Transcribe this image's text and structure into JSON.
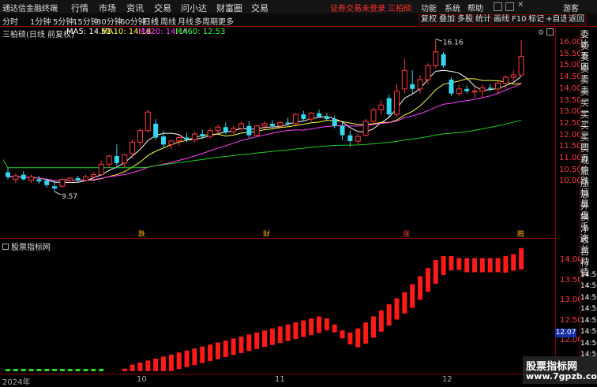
{
  "menubar": {
    "app_title": "通达信金融终端",
    "items": [
      "行情",
      "市场",
      "资讯",
      "交易",
      "问小达",
      "财富圈",
      "交易"
    ],
    "notice": "证券交易未登录  三柏硕",
    "right_items": [
      "功能",
      "系统",
      "帮助",
      "游客"
    ]
  },
  "toolbar": {
    "periods": [
      "分时",
      "1分钟",
      "5分钟",
      "15分钟",
      "30分钟",
      "60分钟",
      "日线",
      "周线",
      "月线",
      "多周期",
      "更多"
    ],
    "active_period": "日线",
    "tools": [
      "复权",
      "叠加",
      "多股",
      "统计",
      "画线",
      "F10",
      "标记",
      "+自选",
      "返回"
    ]
  },
  "main": {
    "stock_name": "三柏硕",
    "adjust_note": "(日线 前复权)",
    "ma": [
      {
        "label": "MA5: 14.51",
        "color": "#ffffff"
      },
      {
        "label": "MA10: 14.18",
        "color": "#ffff40"
      },
      {
        "label": "MA20: 14.14",
        "color": "#ff40ff"
      },
      {
        "label": "MA60: 12.53",
        "color": "#40ff40"
      }
    ],
    "high_label": "16.16",
    "low_label": "9.57",
    "price_axis": [
      "16.00",
      "15.50",
      "15.00",
      "14.50",
      "14.00",
      "13.50",
      "13.00",
      "12.50",
      "12.00",
      "11.50",
      "11.00",
      "10.50",
      "10.00"
    ],
    "markers": [
      "跌",
      "财",
      "涨",
      "腾"
    ]
  },
  "sub": {
    "title": "股票指标网",
    "axis": [
      "14.00",
      "13.50",
      "13.00",
      "12.50",
      "12.00",
      "11.50",
      "11.00"
    ],
    "current_value": "12.07"
  },
  "sidepanel": [
    "委比",
    "卖五",
    "卖四",
    "卖三",
    "卖二",
    "卖一",
    "买一",
    "买二",
    "买三",
    "买四",
    "买五",
    "现价",
    "涨跌",
    "涨幅",
    "总量",
    "外盘",
    "换手",
    "净资",
    "收益",
    "自动",
    "行情",
    "14:50",
    "14:50",
    "14:50",
    "14:50",
    "14:50",
    "14:50",
    "14:50",
    "14:50",
    "14:50"
  ],
  "xaxis": [
    "2024年",
    "10",
    "11",
    "12"
  ],
  "watermark": {
    "line1": "股票指标网",
    "line2": "www.7gpzb.com"
  },
  "chart_data": {
    "type": "candlestick",
    "candles": [
      {
        "o": 10.4,
        "h": 10.6,
        "l": 10.1,
        "c": 10.2
      },
      {
        "o": 10.1,
        "h": 10.35,
        "l": 9.95,
        "c": 10.25
      },
      {
        "o": 10.3,
        "h": 10.45,
        "l": 10.05,
        "c": 10.1
      },
      {
        "o": 10.05,
        "h": 10.3,
        "l": 9.95,
        "c": 10.2
      },
      {
        "o": 10.1,
        "h": 10.25,
        "l": 9.9,
        "c": 10.0
      },
      {
        "o": 10.05,
        "h": 10.15,
        "l": 9.75,
        "c": 9.85
      },
      {
        "o": 9.8,
        "h": 10.05,
        "l": 9.57,
        "c": 9.7
      },
      {
        "o": 9.8,
        "h": 10.15,
        "l": 9.75,
        "c": 10.1
      },
      {
        "o": 10.05,
        "h": 10.2,
        "l": 9.95,
        "c": 10.15
      },
      {
        "o": 10.15,
        "h": 10.25,
        "l": 10.0,
        "c": 10.05
      },
      {
        "o": 10.05,
        "h": 10.3,
        "l": 10.0,
        "c": 10.2
      },
      {
        "o": 10.2,
        "h": 10.4,
        "l": 10.15,
        "c": 10.3
      },
      {
        "o": 10.3,
        "h": 10.9,
        "l": 10.25,
        "c": 10.75
      },
      {
        "o": 10.75,
        "h": 11.15,
        "l": 10.6,
        "c": 11.1
      },
      {
        "o": 11.1,
        "h": 11.6,
        "l": 10.7,
        "c": 10.8
      },
      {
        "o": 10.8,
        "h": 11.2,
        "l": 10.6,
        "c": 11.15
      },
      {
        "o": 11.2,
        "h": 11.8,
        "l": 11.0,
        "c": 11.7
      },
      {
        "o": 11.7,
        "h": 12.3,
        "l": 11.5,
        "c": 12.2
      },
      {
        "o": 12.2,
        "h": 13.1,
        "l": 12.1,
        "c": 13.0
      },
      {
        "o": 12.5,
        "h": 12.7,
        "l": 11.8,
        "c": 11.9
      },
      {
        "o": 11.95,
        "h": 12.2,
        "l": 11.45,
        "c": 11.6
      },
      {
        "o": 11.6,
        "h": 11.8,
        "l": 11.4,
        "c": 11.75
      },
      {
        "o": 11.75,
        "h": 12.0,
        "l": 11.55,
        "c": 11.9
      },
      {
        "o": 11.9,
        "h": 12.1,
        "l": 11.7,
        "c": 11.8
      },
      {
        "o": 11.8,
        "h": 12.15,
        "l": 11.7,
        "c": 12.05
      },
      {
        "o": 12.05,
        "h": 12.25,
        "l": 11.85,
        "c": 11.95
      },
      {
        "o": 11.95,
        "h": 12.3,
        "l": 11.85,
        "c": 12.2
      },
      {
        "o": 12.2,
        "h": 12.45,
        "l": 12.05,
        "c": 12.35
      },
      {
        "o": 12.35,
        "h": 12.55,
        "l": 12.05,
        "c": 12.15
      },
      {
        "o": 12.15,
        "h": 12.4,
        "l": 12.05,
        "c": 12.3
      },
      {
        "o": 12.3,
        "h": 12.6,
        "l": 12.2,
        "c": 12.5
      },
      {
        "o": 12.4,
        "h": 12.6,
        "l": 11.9,
        "c": 12.0
      },
      {
        "o": 12.0,
        "h": 12.45,
        "l": 11.95,
        "c": 12.4
      },
      {
        "o": 12.4,
        "h": 12.6,
        "l": 12.25,
        "c": 12.5
      },
      {
        "o": 12.5,
        "h": 12.65,
        "l": 12.3,
        "c": 12.4
      },
      {
        "o": 12.4,
        "h": 12.6,
        "l": 12.3,
        "c": 12.55
      },
      {
        "o": 12.55,
        "h": 12.75,
        "l": 12.4,
        "c": 12.5
      },
      {
        "o": 12.5,
        "h": 12.95,
        "l": 12.45,
        "c": 12.9
      },
      {
        "o": 12.9,
        "h": 13.05,
        "l": 12.6,
        "c": 12.7
      },
      {
        "o": 12.7,
        "h": 13.0,
        "l": 12.6,
        "c": 12.95
      },
      {
        "o": 12.95,
        "h": 13.1,
        "l": 12.75,
        "c": 12.8
      },
      {
        "o": 12.8,
        "h": 12.95,
        "l": 12.6,
        "c": 12.7
      },
      {
        "o": 12.7,
        "h": 12.85,
        "l": 12.3,
        "c": 12.4
      },
      {
        "o": 12.4,
        "h": 12.6,
        "l": 11.8,
        "c": 12.0
      },
      {
        "o": 12.0,
        "h": 12.2,
        "l": 11.5,
        "c": 11.75
      },
      {
        "o": 11.75,
        "h": 12.05,
        "l": 11.6,
        "c": 11.95
      },
      {
        "o": 12.0,
        "h": 12.7,
        "l": 11.95,
        "c": 12.6
      },
      {
        "o": 12.6,
        "h": 13.2,
        "l": 12.5,
        "c": 13.1
      },
      {
        "o": 13.1,
        "h": 13.5,
        "l": 12.9,
        "c": 13.3
      },
      {
        "o": 13.6,
        "h": 13.75,
        "l": 12.8,
        "c": 12.9
      },
      {
        "o": 12.9,
        "h": 14.2,
        "l": 12.8,
        "c": 13.9
      },
      {
        "o": 14.0,
        "h": 15.3,
        "l": 13.8,
        "c": 14.8
      },
      {
        "o": 14.2,
        "h": 14.8,
        "l": 13.8,
        "c": 14.0
      },
      {
        "o": 14.0,
        "h": 14.6,
        "l": 13.8,
        "c": 14.4
      },
      {
        "o": 14.4,
        "h": 15.1,
        "l": 14.2,
        "c": 15.0
      },
      {
        "o": 15.0,
        "h": 16.16,
        "l": 14.9,
        "c": 15.6
      },
      {
        "o": 15.5,
        "h": 15.6,
        "l": 14.9,
        "c": 15.0
      },
      {
        "o": 14.4,
        "h": 14.5,
        "l": 13.7,
        "c": 13.8
      },
      {
        "o": 13.8,
        "h": 14.2,
        "l": 13.7,
        "c": 14.0
      },
      {
        "o": 14.0,
        "h": 14.15,
        "l": 13.8,
        "c": 13.9
      },
      {
        "o": 13.9,
        "h": 14.1,
        "l": 13.6,
        "c": 13.9
      },
      {
        "o": 13.9,
        "h": 14.2,
        "l": 13.6,
        "c": 14.05
      },
      {
        "o": 14.05,
        "h": 14.2,
        "l": 13.9,
        "c": 14.0
      },
      {
        "o": 14.0,
        "h": 14.4,
        "l": 13.8,
        "c": 14.25
      },
      {
        "o": 14.25,
        "h": 14.6,
        "l": 14.0,
        "c": 14.5
      },
      {
        "o": 14.5,
        "h": 14.8,
        "l": 14.3,
        "c": 14.6
      },
      {
        "o": 14.6,
        "h": 16.1,
        "l": 14.6,
        "c": 15.4
      }
    ],
    "indicator_bars": [
      10.6,
      10.6,
      10.6,
      10.6,
      10.6,
      10.6,
      10.65,
      10.65,
      10.65,
      10.7,
      10.7,
      10.75,
      10.8,
      10.95,
      11.15,
      11.3,
      11.4,
      11.45,
      11.5,
      11.55,
      11.6,
      11.65,
      11.7,
      11.75,
      11.8,
      11.85,
      11.9,
      11.95,
      12.0,
      12.05,
      12.1,
      12.15,
      12.2,
      12.25,
      12.3,
      12.35,
      12.4,
      12.45,
      12.5,
      12.55,
      12.6,
      12.55,
      12.4,
      12.25,
      12.2,
      12.3,
      12.45,
      12.6,
      12.75,
      12.9,
      13.05,
      13.2,
      13.4,
      13.6,
      13.8,
      14.0,
      14.1,
      14.1,
      14.05,
      14.05,
      14.05,
      14.05,
      14.05,
      14.05,
      14.1,
      14.15,
      14.3
    ]
  }
}
